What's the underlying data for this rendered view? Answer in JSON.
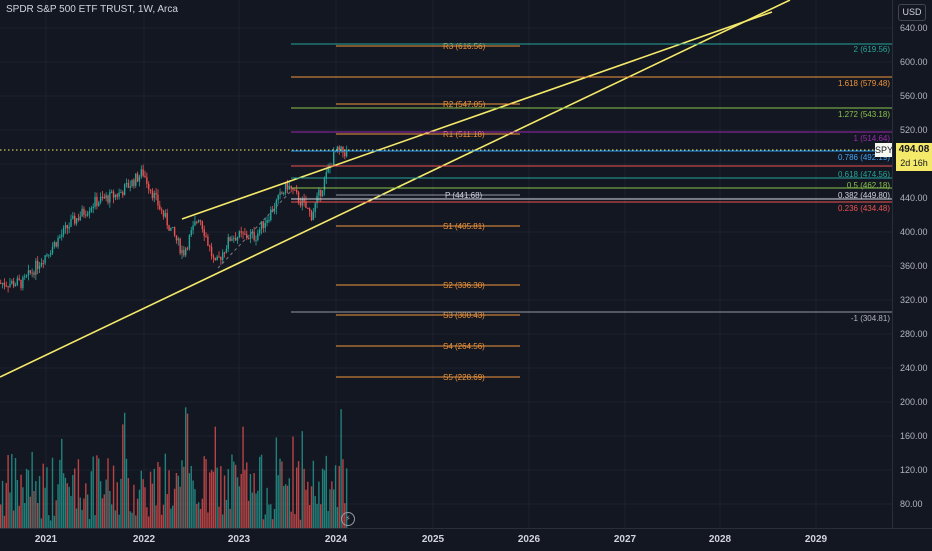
{
  "header": {
    "title": "SPDR S&P 500 ETF TRUST, 1W, Arca"
  },
  "price_scale": {
    "currency_button": "USD",
    "ticks": [
      "640.00",
      "600.00",
      "560.00",
      "520.00",
      "480.00",
      "440.00",
      "400.00",
      "360.00",
      "320.00",
      "280.00",
      "240.00",
      "200.00",
      "160.00",
      "120.00",
      "80.00"
    ],
    "ticker_tag": "SPY",
    "last_price": "494.08",
    "countdown": "2d 16h"
  },
  "time_axis": {
    "ticks": [
      "2021",
      "2022",
      "2023",
      "2024",
      "2025",
      "2026",
      "2027",
      "2028",
      "2029"
    ]
  },
  "pivots": {
    "r3": "R3 (616.56)",
    "r2": "R2 (547.05)",
    "r1": "R1 (511.18)",
    "p": "P (441.68)",
    "s1": "S1 (405.81)",
    "s2": "S2 (336.30)",
    "s3": "S3 (300.43)",
    "s4": "S4 (264.56)",
    "s5": "S5 (228.69)"
  },
  "fib": {
    "f2": "2 (619.56)",
    "f1618": "1.618 (579.48)",
    "f1272": "1.272 (543.18)",
    "f1": "1 (514.64)",
    "f786": "0.786 (492.19)",
    "f618": "0.618 (474.56)",
    "f5": "0.5 (462.18)",
    "f382": "0.382 (449.80)",
    "f236": "0.236 (434.48)",
    "fneg1": "-1 (304.81)"
  },
  "colors": {
    "background": "#131722",
    "up": "#26a69a",
    "down": "#ef5350",
    "trendline": "#f5e96a",
    "pivot": "#f0953a",
    "price_line": "#f5e96a"
  },
  "icons": {
    "lightning": "lightning-icon"
  },
  "chart_data": {
    "type": "candlestick",
    "symbol": "SPY",
    "interval": "1W",
    "exchange": "Arca",
    "last_price": 494.08,
    "y_range": [
      40,
      660
    ],
    "x_range": [
      "2020-09",
      "2029-09"
    ],
    "pivot_levels": {
      "R3": 616.56,
      "R2": 547.05,
      "R1": 511.18,
      "P": 441.68,
      "S1": 405.81,
      "S2": 336.3,
      "S3": 300.43,
      "S4": 264.56,
      "S5": 228.69
    },
    "fib_levels": {
      "2": 619.56,
      "1.618": 579.48,
      "1.272": 543.18,
      "1": 514.64,
      "0.786": 492.19,
      "0.618": 474.56,
      "0.5": 462.18,
      "0.382": 449.8,
      "0.236": 434.48,
      "-1": 304.81
    },
    "price_path_approx": [
      {
        "date": "2020-10",
        "price": 340
      },
      {
        "date": "2021-01",
        "price": 375
      },
      {
        "date": "2021-04",
        "price": 410
      },
      {
        "date": "2021-07",
        "price": 435
      },
      {
        "date": "2021-10",
        "price": 445
      },
      {
        "date": "2022-01",
        "price": 470
      },
      {
        "date": "2022-03",
        "price": 430
      },
      {
        "date": "2022-06",
        "price": 375
      },
      {
        "date": "2022-08",
        "price": 420
      },
      {
        "date": "2022-10",
        "price": 360
      },
      {
        "date": "2022-12",
        "price": 395
      },
      {
        "date": "2023-03",
        "price": 395
      },
      {
        "date": "2023-07",
        "price": 455
      },
      {
        "date": "2023-10",
        "price": 420
      },
      {
        "date": "2023-12",
        "price": 470
      },
      {
        "date": "2024-01",
        "price": 494.08
      }
    ],
    "volume_range_millions": [
      40,
      220
    ]
  }
}
